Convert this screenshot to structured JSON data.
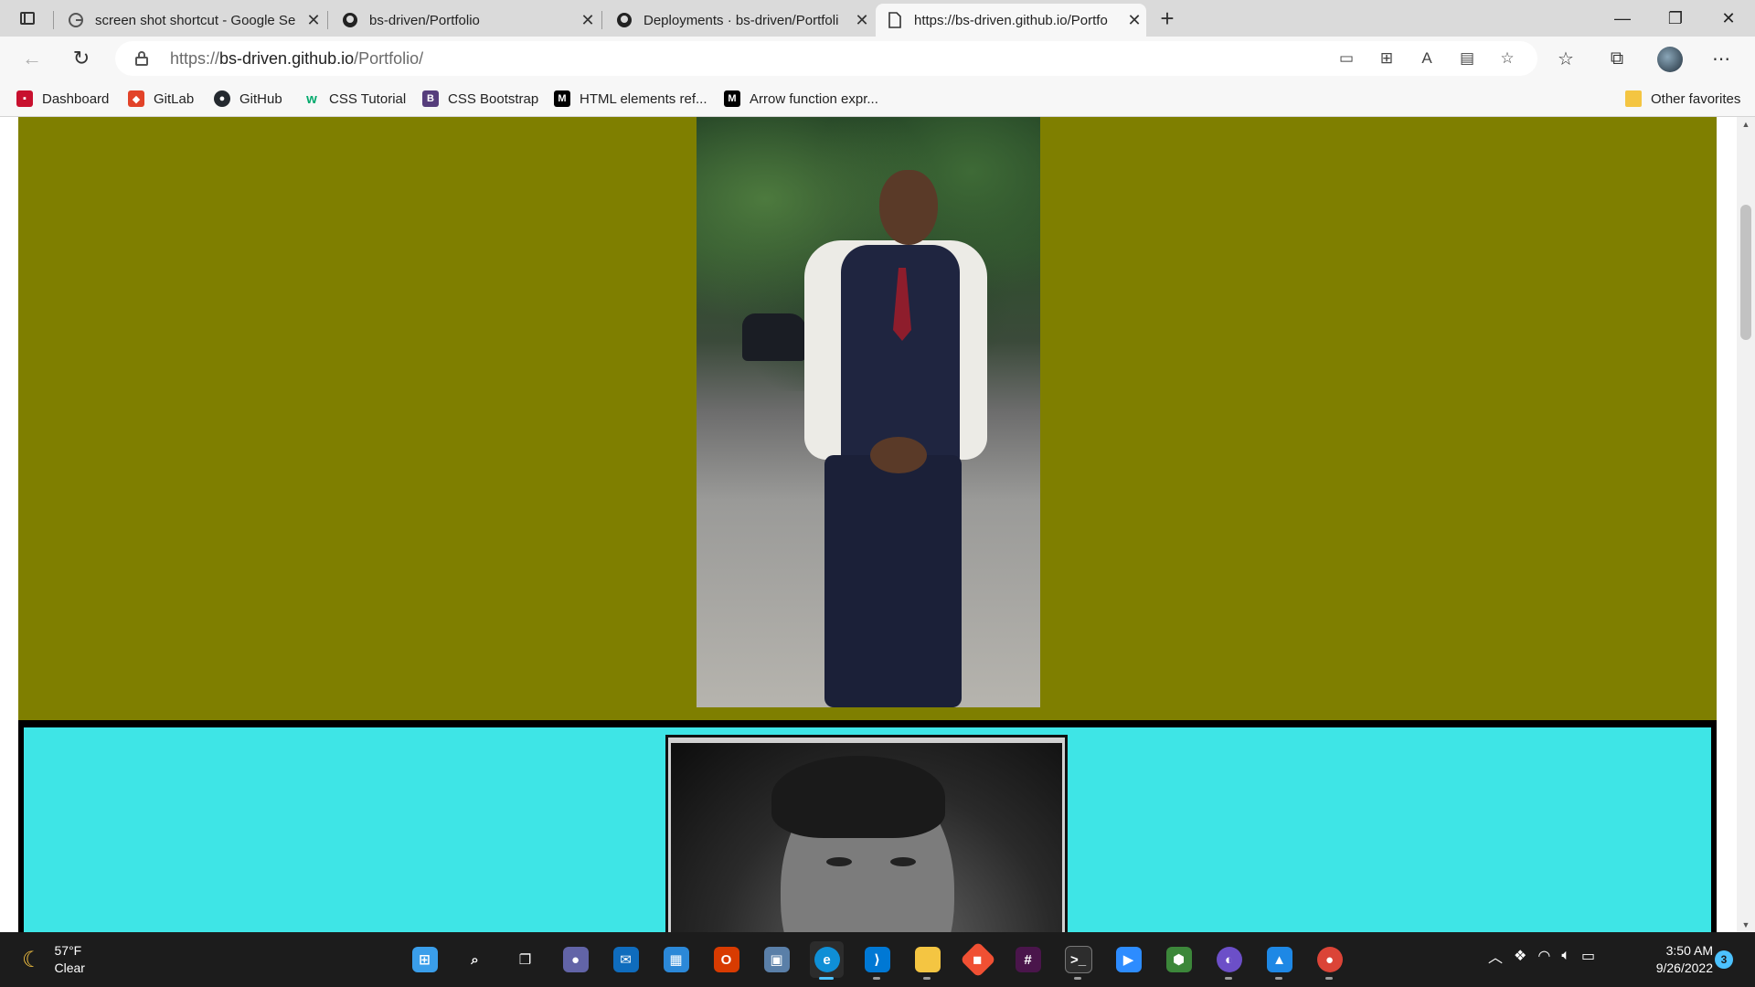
{
  "browser": {
    "tabs": [
      {
        "title": "screen shot shortcut - Google Se",
        "favicon": "google-icon"
      },
      {
        "title": "bs-driven/Portfolio",
        "favicon": "github-icon"
      },
      {
        "title": "Deployments · bs-driven/Portfoli",
        "favicon": "github-icon"
      },
      {
        "title": "https://bs-driven.github.io/Portfo",
        "favicon": "page-icon",
        "active": true
      }
    ],
    "new_tab": "+",
    "close_glyph": "✕",
    "window_controls": {
      "minimize": "—",
      "restore": "❐",
      "close": "✕"
    },
    "url": {
      "scheme": "https://",
      "host": "bs-driven.github.io",
      "path": "/Portfolio/"
    },
    "favorites": [
      {
        "label": "Dashboard",
        "icon": "dashboard-icon",
        "color": "#c8102e"
      },
      {
        "label": "GitLab",
        "icon": "gitlab-icon",
        "color": "#e24329"
      },
      {
        "label": "GitHub",
        "icon": "github-icon",
        "color": "#24292f"
      },
      {
        "label": "CSS Tutorial",
        "icon": "w3schools-icon",
        "color": "#04aa6d"
      },
      {
        "label": "CSS Bootstrap",
        "icon": "bootstrap-icon",
        "color": "#563d7c"
      },
      {
        "label": "HTML elements ref...",
        "icon": "mdn-icon",
        "color": "#000000"
      },
      {
        "label": "Arrow function expr...",
        "icon": "mdn-icon",
        "color": "#000000"
      }
    ],
    "other_favorites": "Other favorites"
  },
  "page": {
    "section1_bg": "#7f7f00",
    "section2_bg": "#3ee5e6",
    "photo1_alt": "full-length portrait photo",
    "photo2_alt": "black and white headshot"
  },
  "taskbar": {
    "weather": {
      "temp": "57°F",
      "condition": "Clear"
    },
    "apps": [
      {
        "name": "start-button",
        "icon": "windows-icon",
        "color": "#3a9eea"
      },
      {
        "name": "search-button",
        "icon": "search-icon",
        "color": "#1c1c1c"
      },
      {
        "name": "task-view",
        "icon": "task-view-icon",
        "color": "#1c1c1c"
      },
      {
        "name": "teams-chat",
        "icon": "teams-icon",
        "color": "#6264a7"
      },
      {
        "name": "mail",
        "icon": "mail-icon",
        "color": "#0f6cbd"
      },
      {
        "name": "microsoft-store",
        "icon": "store-icon",
        "color": "#2b88d8"
      },
      {
        "name": "office",
        "icon": "office-icon",
        "color": "#d83b01"
      },
      {
        "name": "network-app",
        "icon": "network-icon",
        "color": "#5a7fa8"
      },
      {
        "name": "edge",
        "icon": "edge-icon",
        "color": "#0f8fd6",
        "active": true
      },
      {
        "name": "vscode",
        "icon": "vscode-icon",
        "color": "#0078d4"
      },
      {
        "name": "file-explorer",
        "icon": "folder-icon",
        "color": "#f4c542"
      },
      {
        "name": "git",
        "icon": "git-icon",
        "color": "#f05033"
      },
      {
        "name": "slack",
        "icon": "slack-icon",
        "color": "#4a154b"
      },
      {
        "name": "terminal",
        "icon": "terminal-icon",
        "color": "#2d2d2d"
      },
      {
        "name": "zoom",
        "icon": "zoom-icon",
        "color": "#2d8cff"
      },
      {
        "name": "node",
        "icon": "node-icon",
        "color": "#3c873a"
      },
      {
        "name": "eclipse",
        "icon": "eclipse-icon",
        "color": "#6c4fc8"
      },
      {
        "name": "photos",
        "icon": "photos-icon",
        "color": "#1e88e5"
      },
      {
        "name": "chrome",
        "icon": "chrome-icon",
        "color": "#db4437"
      }
    ],
    "clock": {
      "time": "3:50 AM",
      "date": "9/26/2022"
    },
    "notifications": "3"
  }
}
